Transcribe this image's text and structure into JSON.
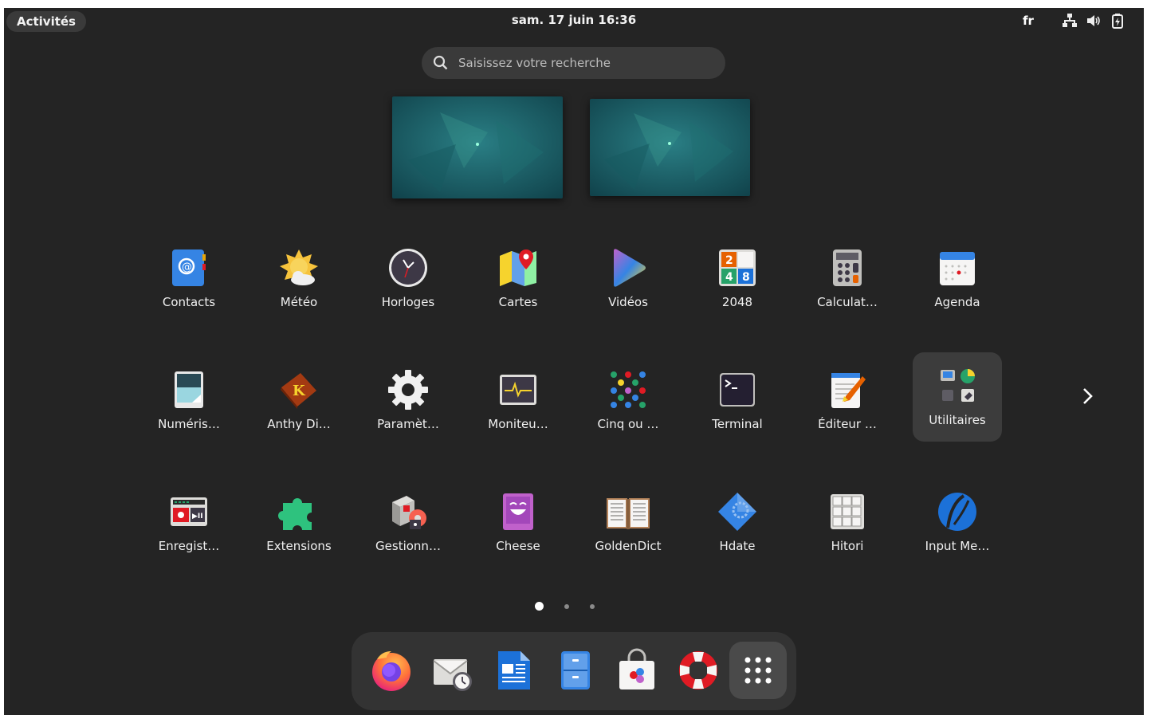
{
  "topbar": {
    "activities_label": "Activités",
    "clock": "sam. 17 juin  16:36",
    "language": "fr",
    "tray_icons": [
      "network-icon",
      "volume-icon",
      "battery-icon"
    ]
  },
  "search": {
    "placeholder": "Saisissez votre recherche"
  },
  "workspaces": [
    "workspace-1",
    "workspace-2"
  ],
  "apps": [
    {
      "label": "Contacts",
      "icon": "contacts-icon"
    },
    {
      "label": "Météo",
      "icon": "weather-icon"
    },
    {
      "label": "Horloges",
      "icon": "clock-icon"
    },
    {
      "label": "Cartes",
      "icon": "maps-icon"
    },
    {
      "label": "Vidéos",
      "icon": "videos-icon"
    },
    {
      "label": "2048",
      "icon": "game-2048-icon"
    },
    {
      "label": "Calculat…",
      "icon": "calculator-icon"
    },
    {
      "label": "Agenda",
      "icon": "calendar-icon"
    },
    {
      "label": "Numéris…",
      "icon": "scanner-icon"
    },
    {
      "label": "Anthy Di…",
      "icon": "dictionary-book-icon"
    },
    {
      "label": "Paramèt…",
      "icon": "settings-gear-icon"
    },
    {
      "label": "Moniteu…",
      "icon": "system-monitor-icon"
    },
    {
      "label": "Cinq ou …",
      "icon": "five-or-more-icon"
    },
    {
      "label": "Terminal",
      "icon": "terminal-icon"
    },
    {
      "label": "Éditeur …",
      "icon": "text-editor-icon"
    },
    {
      "label": "Utilitaires",
      "icon": "utilities-folder-icon"
    },
    {
      "label": "Enregist…",
      "icon": "recorder-icon"
    },
    {
      "label": "Extensions",
      "icon": "extensions-puzzle-icon"
    },
    {
      "label": "Gestionn…",
      "icon": "package-manager-icon"
    },
    {
      "label": "Cheese",
      "icon": "cheese-camera-icon"
    },
    {
      "label": "GoldenDict",
      "icon": "goldendict-book-icon"
    },
    {
      "label": "Hdate",
      "icon": "hdate-icon"
    },
    {
      "label": "Hitori",
      "icon": "hitori-icon"
    },
    {
      "label": "Input Me…",
      "icon": "input-method-icon"
    }
  ],
  "pagination": {
    "pages": 3,
    "current": 1
  },
  "dock": [
    "firefox-icon",
    "evolution-mail-icon",
    "writer-document-icon",
    "files-cabinet-icon",
    "software-store-icon",
    "help-lifebuoy-icon",
    "show-apps-grid-icon"
  ]
}
